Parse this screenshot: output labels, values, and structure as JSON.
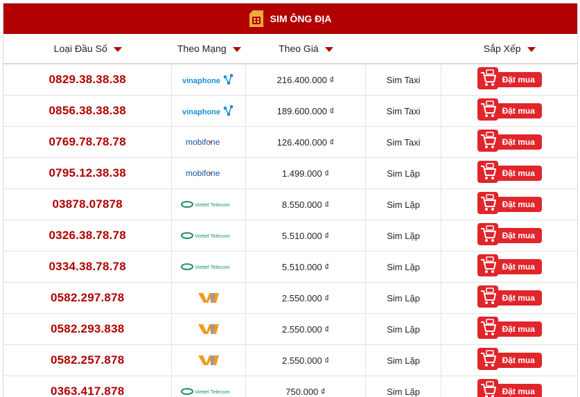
{
  "header": {
    "title": "SIM ÔNG ĐỊA",
    "icon": "sim-card-icon"
  },
  "columns": [
    {
      "label": "Loại Đầu Số"
    },
    {
      "label": "Theo Mạng"
    },
    {
      "label": "Theo Giá"
    },
    {
      "label": "Sắp Xếp"
    }
  ],
  "buy_label": "Đặt mua",
  "colors": {
    "brand_red": "#b00000",
    "button_red": "#e0252b",
    "vinaphone_blue": "#1a8fd6",
    "mobifone_blue": "#1f4ea3",
    "viettel_green": "#1e8f6a",
    "viettel_orange": "#ee7b2d",
    "vietnamobile_orange": "#f29a22"
  },
  "rows": [
    {
      "number": "0829.38.38.38",
      "network": "vinaphone",
      "price": "216.400.000 ₫",
      "type": "Sim Taxi"
    },
    {
      "number": "0856.38.38.38",
      "network": "vinaphone",
      "price": "189.600.000 ₫",
      "type": "Sim Taxi"
    },
    {
      "number": "0769.78.78.78",
      "network": "mobifone",
      "price": "126.400.000 ₫",
      "type": "Sim Taxi"
    },
    {
      "number": "0795.12.38.38",
      "network": "mobifone",
      "price": "1.499.000 ₫",
      "type": "Sim Lặp"
    },
    {
      "number": "03878.07878",
      "network": "viettel",
      "price": "8.550.000 ₫",
      "type": "Sim Lặp"
    },
    {
      "number": "0326.38.78.78",
      "network": "viettel",
      "price": "5.510.000 ₫",
      "type": "Sim Lặp"
    },
    {
      "number": "0334.38.78.78",
      "network": "viettel",
      "price": "5.510.000 ₫",
      "type": "Sim Lặp"
    },
    {
      "number": "0582.297.878",
      "network": "vietnamobile",
      "price": "2.550.000 ₫",
      "type": "Sim Lặp"
    },
    {
      "number": "0582.293.838",
      "network": "vietnamobile",
      "price": "2.550.000 ₫",
      "type": "Sim Lặp"
    },
    {
      "number": "0582.257.878",
      "network": "vietnamobile",
      "price": "2.550.000 ₫",
      "type": "Sim Lặp"
    },
    {
      "number": "0363.417.878",
      "network": "viettel",
      "price": "750.000 ₫",
      "type": "Sim Lặp"
    }
  ],
  "logo_text": {
    "vinaphone": "vinaphone",
    "mobifone": "mobifone",
    "viettel": "Viettel Telecom"
  }
}
